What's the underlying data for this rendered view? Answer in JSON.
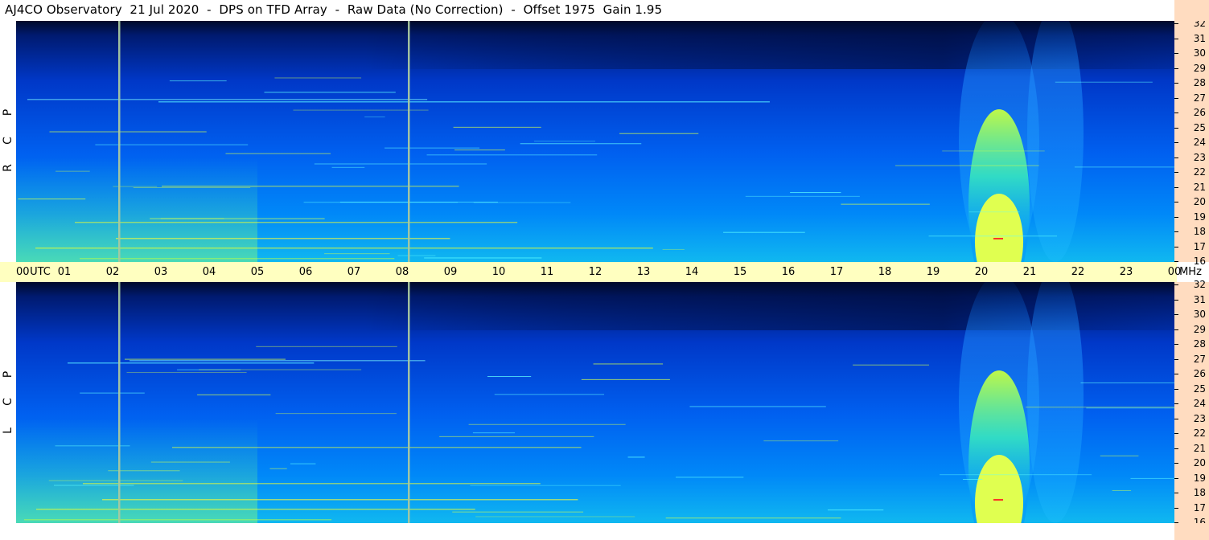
{
  "title": "AJ4CO Observatory  21 Jul 2020  -  DPS on TFD Array  -  Raw Data (No Correction)  -  Offset 1975  Gain 1.95",
  "panels": [
    {
      "id": "rcp",
      "label_chars": [
        "P",
        "C",
        "R"
      ]
    },
    {
      "id": "lcp",
      "label_chars": [
        "P",
        "C",
        "L"
      ]
    }
  ],
  "time_axis": {
    "ticks": [
      "00",
      "UTC",
      "01",
      "02",
      "03",
      "04",
      "05",
      "06",
      "07",
      "08",
      "09",
      "10",
      "11",
      "12",
      "13",
      "14",
      "15",
      "16",
      "17",
      "18",
      "19",
      "20",
      "21",
      "22",
      "23",
      "00",
      "MHz"
    ]
  },
  "freq_axis": {
    "ticks": [
      "32",
      "31",
      "30",
      "29",
      "28",
      "27",
      "26",
      "25",
      "24",
      "23",
      "22",
      "21",
      "20",
      "19",
      "18",
      "17",
      "16"
    ]
  },
  "colors": {
    "time_axis_bg": "#ffffc0",
    "freq_axis_bg": "#ffdcc0",
    "spectrogram_dark": "#000a2a",
    "spectrogram_mid": "#0050e0",
    "spectrogram_hot": "#c8ff40"
  }
}
